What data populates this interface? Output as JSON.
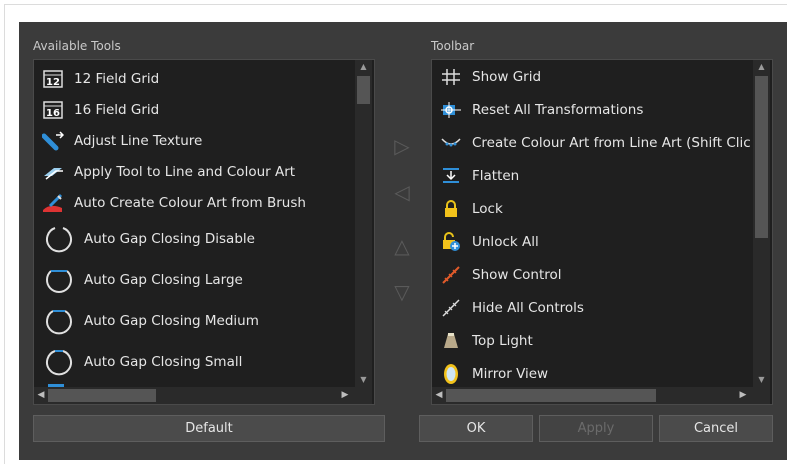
{
  "available": {
    "heading": "Available Tools",
    "items": [
      {
        "label": "12 Field Grid",
        "icon": "field-grid-12-icon",
        "badge": "12"
      },
      {
        "label": "16 Field Grid",
        "icon": "field-grid-16-icon",
        "badge": "16"
      },
      {
        "label": "Adjust Line Texture",
        "icon": "adjust-line-texture-icon"
      },
      {
        "label": "Apply Tool to Line and Colour Art",
        "icon": "apply-tool-icon"
      },
      {
        "label": "Auto Create Colour Art from Brush",
        "icon": "auto-colour-brush-icon"
      },
      {
        "label": "Auto Gap Closing Disable",
        "icon": "gap-closing-disable-icon"
      },
      {
        "label": "Auto Gap Closing Large",
        "icon": "gap-closing-large-icon"
      },
      {
        "label": "Auto Gap Closing Medium",
        "icon": "gap-closing-medium-icon"
      },
      {
        "label": "Auto Gap Closing Small",
        "icon": "gap-closing-small-icon"
      }
    ]
  },
  "toolbar": {
    "heading": "Toolbar",
    "items": [
      {
        "label": "Show Grid",
        "icon": "grid-icon"
      },
      {
        "label": "Reset All Transformations",
        "icon": "reset-transform-icon"
      },
      {
        "label": "Create Colour Art from Line Art (Shift Clic",
        "icon": "create-colour-art-icon"
      },
      {
        "label": "Flatten",
        "icon": "flatten-icon"
      },
      {
        "label": "Lock",
        "icon": "lock-icon"
      },
      {
        "label": "Unlock All",
        "icon": "unlock-all-icon"
      },
      {
        "label": "Show Control",
        "icon": "show-control-icon"
      },
      {
        "label": "Hide All Controls",
        "icon": "hide-controls-icon"
      },
      {
        "label": "Top Light",
        "icon": "top-light-icon"
      },
      {
        "label": "Mirror View",
        "icon": "mirror-view-icon"
      }
    ]
  },
  "transfer": {
    "add": "▷",
    "remove": "◁",
    "up": "△",
    "down": "▽"
  },
  "buttons": {
    "default": "Default",
    "ok": "OK",
    "apply": "Apply",
    "cancel": "Cancel"
  },
  "colors": {
    "dialog_bg": "#3b3b3b",
    "list_bg": "#1f1f1f",
    "accent_blue": "#2f8fd8"
  }
}
